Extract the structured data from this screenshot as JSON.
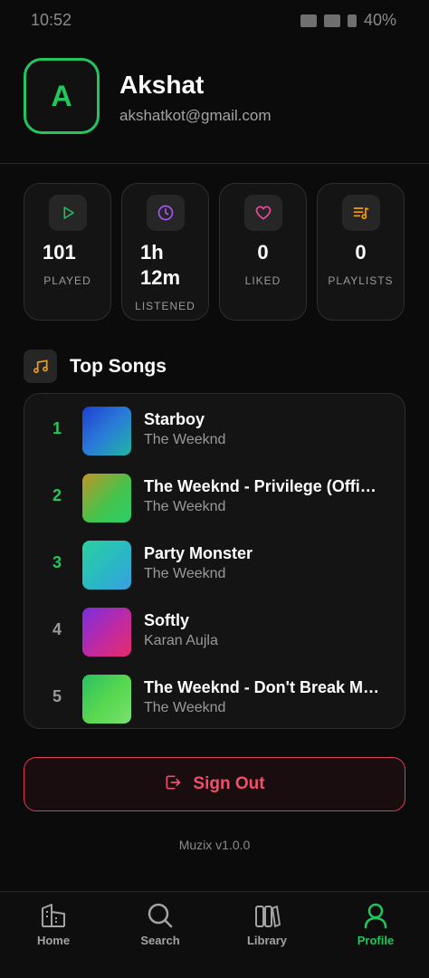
{
  "status": {
    "time": "10:52",
    "battery": "40%"
  },
  "profile": {
    "initial": "A",
    "name": "Akshat",
    "email": "akshatkot@gmail.com"
  },
  "stats": [
    {
      "icon": "play-icon",
      "value": "101",
      "label": "PLAYED",
      "color": "#22c55e"
    },
    {
      "icon": "clock-icon",
      "value": "1h 12m",
      "label": "LISTENED",
      "color": "#a855f7"
    },
    {
      "icon": "heart-icon",
      "value": "0",
      "label": "LIKED",
      "color": "#ec4899"
    },
    {
      "icon": "playlist-icon",
      "value": "0",
      "label": "PLAYLISTS",
      "color": "#f59e0b"
    }
  ],
  "top_songs": {
    "title": "Top Songs",
    "items": [
      {
        "rank": "1",
        "title": "Starboy",
        "artist": "The Weeknd"
      },
      {
        "rank": "2",
        "title": "The Weeknd - Privilege (Official Audio)",
        "artist": "The Weeknd"
      },
      {
        "rank": "3",
        "title": "Party Monster",
        "artist": "The Weeknd"
      },
      {
        "rank": "4",
        "title": "Softly",
        "artist": "Karan Aujla"
      },
      {
        "rank": "5",
        "title": "The Weeknd - Don't Break My Heart",
        "artist": "The Weeknd"
      }
    ]
  },
  "sign_out_label": "Sign Out",
  "version": "Muzix v1.0.0",
  "nav": [
    {
      "label": "Home",
      "icon": "home-icon"
    },
    {
      "label": "Search",
      "icon": "search-icon"
    },
    {
      "label": "Library",
      "icon": "library-icon"
    },
    {
      "label": "Profile",
      "icon": "profile-icon"
    }
  ],
  "colors": {
    "accent": "#22c55e",
    "danger": "#ef4f6b",
    "background": "#0b0b0b",
    "card": "#141414"
  }
}
